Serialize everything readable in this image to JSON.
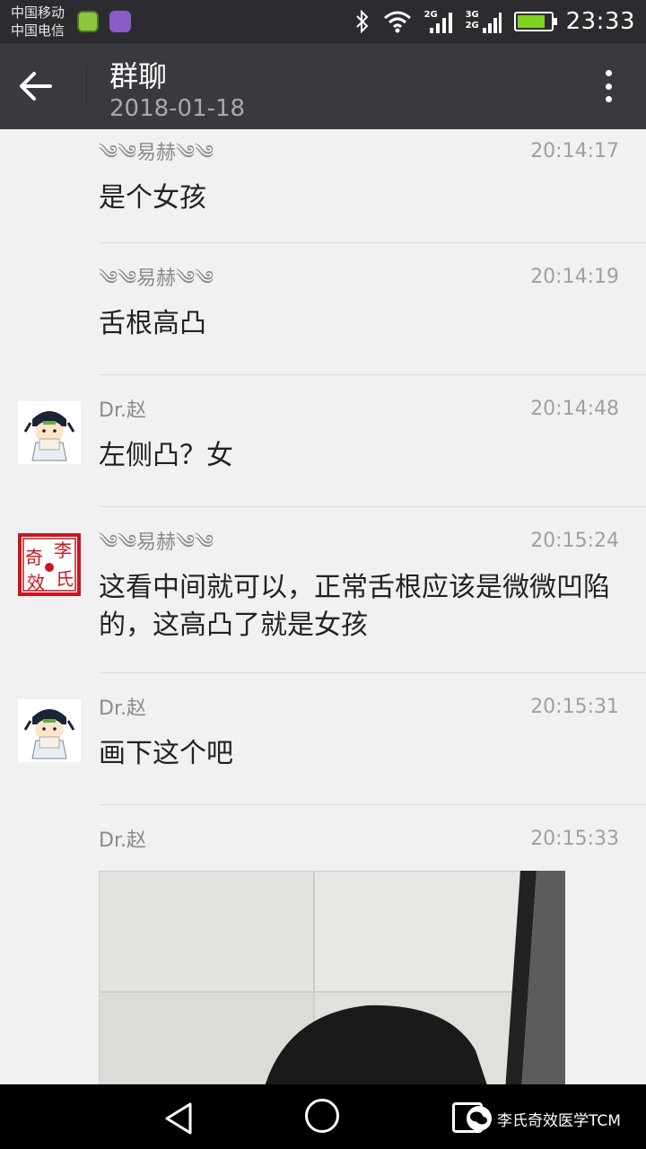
{
  "status_bar": {
    "carrier_1": "中国移动",
    "carrier_2": "中国电信",
    "network_1": "2G",
    "network_2a": "3G",
    "network_2b": "2G",
    "time": "23:33"
  },
  "header": {
    "title": "群聊",
    "subtitle": "2018-01-18"
  },
  "messages": [
    {
      "sender": "༄༄易赫༄༄",
      "time": "20:14:17",
      "text": "是个女孩"
    },
    {
      "sender": "༄༄易赫༄༄",
      "time": "20:14:19",
      "text": "舌根高凸"
    },
    {
      "sender": "Dr.赵",
      "time": "20:14:48",
      "text": "左侧凸？女"
    },
    {
      "sender": "༄༄易赫༄༄",
      "time": "20:15:24",
      "text": "这看中间就可以，正常舌根应该是微微凹陷的，这高凸了就是女孩"
    },
    {
      "sender": "Dr.赵",
      "time": "20:15:31",
      "text": "画下这个吧"
    },
    {
      "sender": "Dr.赵",
      "time": "20:15:33",
      "text": ""
    }
  ],
  "avatar_logo": {
    "chars": [
      "奇",
      "李",
      "效",
      "氏"
    ]
  },
  "watermark": {
    "text": "李氏奇效医学TCM"
  },
  "colors": {
    "status_bg": "#2c2c30",
    "header_bg": "#393a3f",
    "page_bg": "#f1f1f3",
    "logo_red": "#c8161d"
  }
}
